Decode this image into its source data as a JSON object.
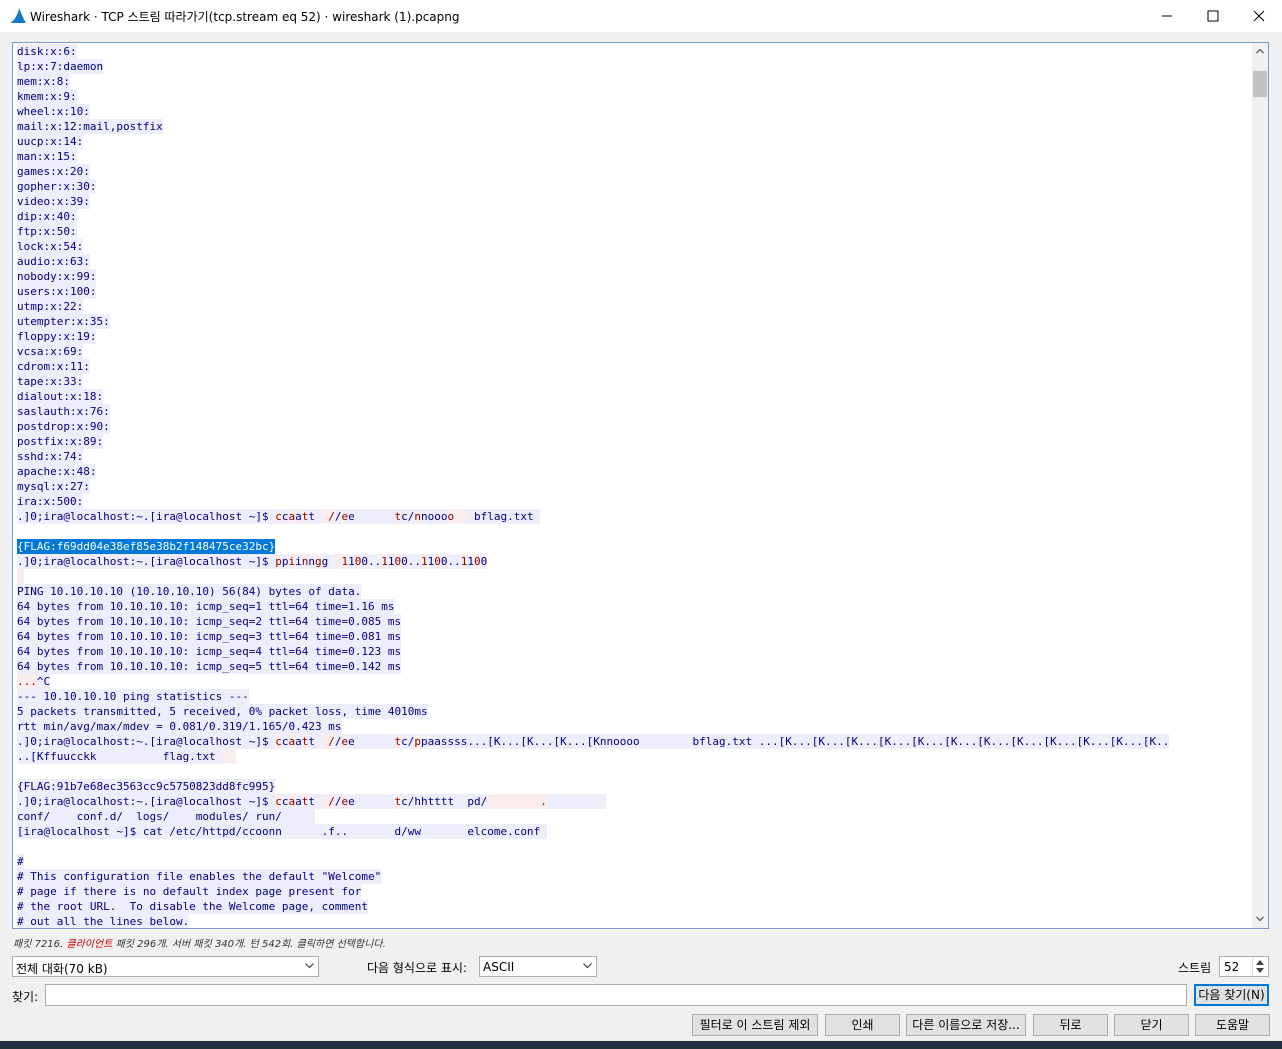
{
  "window": {
    "title": "Wireshark · TCP 스트림 따라가기(tcp.stream eq 52) · wireshark (1).pcapng",
    "controls": [
      "minimize-icon",
      "maximize-icon",
      "close-icon"
    ]
  },
  "stream_lines": [
    {
      "dir": "server",
      "text": "disk:x:6:"
    },
    {
      "dir": "server",
      "text": "lp:x:7:daemon"
    },
    {
      "dir": "server",
      "text": "mem:x:8:"
    },
    {
      "dir": "server",
      "text": "kmem:x:9:"
    },
    {
      "dir": "server",
      "text": "wheel:x:10:"
    },
    {
      "dir": "server",
      "text": "mail:x:12:mail,postfix"
    },
    {
      "dir": "server",
      "text": "uucp:x:14:"
    },
    {
      "dir": "server",
      "text": "man:x:15:"
    },
    {
      "dir": "server",
      "text": "games:x:20:"
    },
    {
      "dir": "server",
      "text": "gopher:x:30:"
    },
    {
      "dir": "server",
      "text": "video:x:39:"
    },
    {
      "dir": "server",
      "text": "dip:x:40:"
    },
    {
      "dir": "server",
      "text": "ftp:x:50:"
    },
    {
      "dir": "server",
      "text": "lock:x:54:"
    },
    {
      "dir": "server",
      "text": "audio:x:63:"
    },
    {
      "dir": "server",
      "text": "nobody:x:99:"
    },
    {
      "dir": "server",
      "text": "users:x:100:"
    },
    {
      "dir": "server",
      "text": "utmp:x:22:"
    },
    {
      "dir": "server",
      "text": "utempter:x:35:"
    },
    {
      "dir": "server",
      "text": "floppy:x:19:"
    },
    {
      "dir": "server",
      "text": "vcsa:x:69:"
    },
    {
      "dir": "server",
      "text": "cdrom:x:11:"
    },
    {
      "dir": "server",
      "text": "tape:x:33:"
    },
    {
      "dir": "server",
      "text": "dialout:x:18:"
    },
    {
      "dir": "server",
      "text": "saslauth:x:76:"
    },
    {
      "dir": "server",
      "text": "postdrop:x:90:"
    },
    {
      "dir": "server",
      "text": "postfix:x:89:"
    },
    {
      "dir": "server",
      "text": "sshd:x:74:"
    },
    {
      "dir": "server",
      "text": "apache:x:48:"
    },
    {
      "dir": "server",
      "text": "mysql:x:27:"
    },
    {
      "dir": "server",
      "text": "ira:x:500:"
    },
    {
      "dir": "mixed",
      "segments": [
        {
          "dir": "server",
          "text": ".]0;ira@localhost:~.[ira@localhost ~]$ "
        },
        {
          "dir": "client",
          "text": "c"
        },
        {
          "dir": "server",
          "text": "c"
        },
        {
          "dir": "client",
          "text": "a"
        },
        {
          "dir": "server",
          "text": "a"
        },
        {
          "dir": "client",
          "text": "t"
        },
        {
          "dir": "server",
          "text": "t "
        },
        {
          "dir": "client",
          "text": " /"
        },
        {
          "dir": "server",
          "text": "/"
        },
        {
          "dir": "client",
          "text": "e"
        },
        {
          "dir": "server",
          "text": "e      "
        },
        {
          "dir": "client",
          "text": "t"
        },
        {
          "dir": "server",
          "text": "c/"
        },
        {
          "dir": "client",
          "text": "n"
        },
        {
          "dir": "server",
          "text": "nooo"
        },
        {
          "dir": "client",
          "text": "o  "
        },
        {
          "dir": "server",
          "text": " bflag.txt "
        }
      ]
    },
    {
      "dir": "none",
      "text": ""
    },
    {
      "dir": "selected",
      "text": "{FLAG:f69dd04e38ef85e38b2f148475ce32bc}"
    },
    {
      "dir": "mixed",
      "segments": [
        {
          "dir": "server",
          "text": ".]0;ira@localhost:~.[ira@localhost ~]$ "
        },
        {
          "dir": "client",
          "text": "p"
        },
        {
          "dir": "server",
          "text": "p"
        },
        {
          "dir": "client",
          "text": "i"
        },
        {
          "dir": "server",
          "text": "i"
        },
        {
          "dir": "client",
          "text": "n"
        },
        {
          "dir": "server",
          "text": "n"
        },
        {
          "dir": "client",
          "text": "g"
        },
        {
          "dir": "server",
          "text": "g "
        },
        {
          "dir": "client",
          "text": " 1"
        },
        {
          "dir": "server",
          "text": "1"
        },
        {
          "dir": "client",
          "text": "0"
        },
        {
          "dir": "server",
          "text": "0.."
        },
        {
          "dir": "client",
          "text": "1"
        },
        {
          "dir": "server",
          "text": "1"
        },
        {
          "dir": "client",
          "text": "0"
        },
        {
          "dir": "server",
          "text": "0.."
        },
        {
          "dir": "client",
          "text": "1"
        },
        {
          "dir": "server",
          "text": "1"
        },
        {
          "dir": "client",
          "text": "0"
        },
        {
          "dir": "server",
          "text": "0.."
        },
        {
          "dir": "client",
          "text": "1"
        },
        {
          "dir": "server",
          "text": "1"
        },
        {
          "dir": "client",
          "text": "0"
        },
        {
          "dir": "server",
          "text": "0"
        }
      ]
    },
    {
      "dir": "client",
      "text": " "
    },
    {
      "dir": "server",
      "text": "PING 10.10.10.10 (10.10.10.10) 56(84) bytes of data."
    },
    {
      "dir": "server",
      "text": "64 bytes from 10.10.10.10: icmp_seq=1 ttl=64 time=1.16 ms"
    },
    {
      "dir": "server",
      "text": "64 bytes from 10.10.10.10: icmp_seq=2 ttl=64 time=0.085 ms"
    },
    {
      "dir": "server",
      "text": "64 bytes from 10.10.10.10: icmp_seq=3 ttl=64 time=0.081 ms"
    },
    {
      "dir": "server",
      "text": "64 bytes from 10.10.10.10: icmp_seq=4 ttl=64 time=0.123 ms"
    },
    {
      "dir": "server",
      "text": "64 bytes from 10.10.10.10: icmp_seq=5 ttl=64 time=0.142 ms"
    },
    {
      "dir": "mixed",
      "segments": [
        {
          "dir": "client",
          "text": "..."
        },
        {
          "dir": "server",
          "text": "^C"
        }
      ]
    },
    {
      "dir": "server",
      "text": "--- 10.10.10.10 ping statistics ---"
    },
    {
      "dir": "server",
      "text": "5 packets transmitted, 5 received, 0% packet loss, time 4010ms"
    },
    {
      "dir": "server",
      "text": "rtt min/avg/max/mdev = 0.081/0.319/1.165/0.423 ms"
    },
    {
      "dir": "mixed",
      "segments": [
        {
          "dir": "server",
          "text": ".]0;ira@localhost:~.[ira@localhost ~]$ "
        },
        {
          "dir": "client",
          "text": "c"
        },
        {
          "dir": "server",
          "text": "c"
        },
        {
          "dir": "client",
          "text": "a"
        },
        {
          "dir": "server",
          "text": "a"
        },
        {
          "dir": "client",
          "text": "t"
        },
        {
          "dir": "server",
          "text": "t "
        },
        {
          "dir": "client",
          "text": " /"
        },
        {
          "dir": "server",
          "text": "/"
        },
        {
          "dir": "client",
          "text": "e"
        },
        {
          "dir": "server",
          "text": "e      "
        },
        {
          "dir": "client",
          "text": "t"
        },
        {
          "dir": "server",
          "text": "c/"
        },
        {
          "dir": "client",
          "text": "p"
        },
        {
          "dir": "server",
          "text": "paassss...[K...[K...[K...[Knnoooo        bflag.txt ...[K...[K...[K...[K...[K...[K...[K...[K...[K...[K...[K...[K.."
        }
      ]
    },
    {
      "dir": "mixed",
      "segments": [
        {
          "dir": "server",
          "text": "..[Kffuucckk          flag.txt "
        },
        {
          "dir": "client",
          "text": "  "
        }
      ]
    },
    {
      "dir": "none",
      "text": ""
    },
    {
      "dir": "server",
      "text": "{FLAG:91b7e68ec3563cc9c5750823dd8fc995}"
    },
    {
      "dir": "mixed",
      "segments": [
        {
          "dir": "server",
          "text": ".]0;ira@localhost:~.[ira@localhost ~]$ "
        },
        {
          "dir": "client",
          "text": "c"
        },
        {
          "dir": "server",
          "text": "c"
        },
        {
          "dir": "client",
          "text": "a"
        },
        {
          "dir": "server",
          "text": "a"
        },
        {
          "dir": "client",
          "text": "t"
        },
        {
          "dir": "server",
          "text": "t "
        },
        {
          "dir": "client",
          "text": " /"
        },
        {
          "dir": "server",
          "text": "/"
        },
        {
          "dir": "client",
          "text": "e"
        },
        {
          "dir": "server",
          "text": "e      "
        },
        {
          "dir": "client",
          "text": "t"
        },
        {
          "dir": "server",
          "text": "c/hhtttt  pd/"
        },
        {
          "dir": "client",
          "text": "        ."
        },
        {
          "dir": "server",
          "text": "         "
        }
      ]
    },
    {
      "dir": "server",
      "text": "conf/    conf.d/  logs/    modules/ run/     "
    },
    {
      "dir": "mixed",
      "segments": [
        {
          "dir": "server",
          "text": "[ira@localhost ~]$ cat /etc/httpd/ccoonn      .f..       d/ww       elcome.conf "
        }
      ]
    },
    {
      "dir": "none",
      "text": ""
    },
    {
      "dir": "server",
      "text": "#"
    },
    {
      "dir": "server",
      "text": "# This configuration file enables the default \"Welcome\""
    },
    {
      "dir": "server",
      "text": "# page if there is no default index page present for"
    },
    {
      "dir": "server",
      "text": "# the root URL.  To disable the Welcome page, comment"
    },
    {
      "dir": "server",
      "text": "# out all the lines below."
    }
  ],
  "status": {
    "prefix": "패킷 7216. ",
    "client_label": "클라이언트",
    "suffix": " 패킷 296개. 서버 패킷 340개. 턴 542회. 클릭하면 선택합니다."
  },
  "controls": {
    "conversation_select": "전체 대화(70 kB)",
    "show_as_label": "다음 형식으로 표시:",
    "show_as_select": "ASCII",
    "stream_label": "스트림",
    "stream_value": "52",
    "find_label": "찾기:",
    "find_value": "",
    "find_next_button": "다음 찾기(N)"
  },
  "buttons": {
    "filter_out": "필터로 이 스트림 제외",
    "print": "인쇄",
    "save_as": "다른 이름으로 저장...",
    "back": "뒤로",
    "close": "닫기",
    "help": "도움말"
  },
  "colors": {
    "client_bg": "#fbeded",
    "client_fg": "#7f0000",
    "server_bg": "#ededfb",
    "server_fg": "#00007f",
    "selection": "#0078d7"
  }
}
